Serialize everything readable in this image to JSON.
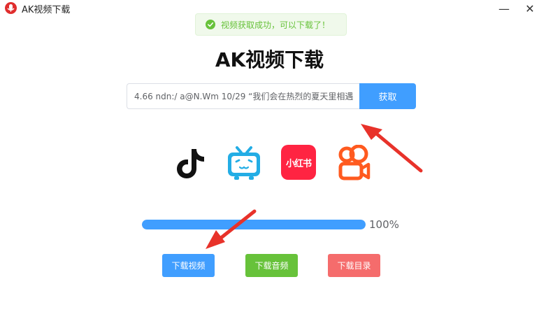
{
  "window": {
    "title": "AK视频下载",
    "minimize_glyph": "—",
    "close_glyph": "✕"
  },
  "toast": {
    "message": "视频获取成功，可以下载了！",
    "status_color": "#67c23a"
  },
  "main": {
    "headline": "AK视频下载",
    "url_input_value": "4.66 ndn:/ a@N.Wm 10/29 “我们会在热烈的夏天里相遇",
    "fetch_label": "获取"
  },
  "platforms": [
    {
      "name": "tiktok-icon"
    },
    {
      "name": "bilibili-icon"
    },
    {
      "name": "xiaohongshu-icon",
      "label": "小红书"
    },
    {
      "name": "kuaishou-icon"
    }
  ],
  "progress": {
    "percent": 100,
    "label": "100%"
  },
  "actions": {
    "download_video": "下载视频",
    "download_audio": "下载音频",
    "download_dir": "下载目录"
  },
  "colors": {
    "primary": "#409eff",
    "success": "#67c23a",
    "danger": "#f56c6c",
    "annotation_arrow": "#e8322a"
  }
}
